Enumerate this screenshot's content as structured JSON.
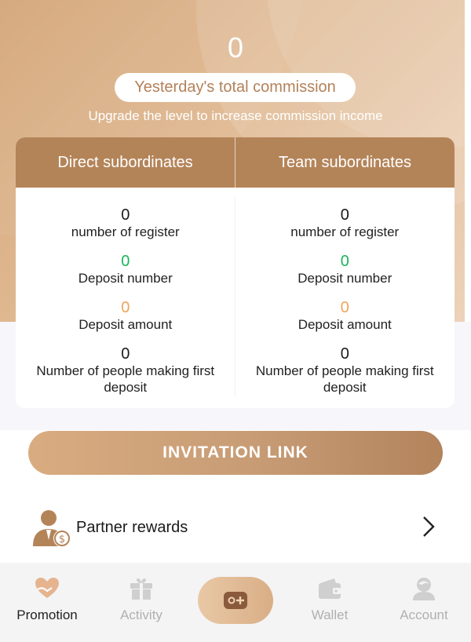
{
  "header": {
    "commission_value": "0",
    "commission_label": "Yesterday's total commission",
    "upgrade_text": "Upgrade the level to increase commission income"
  },
  "subordinates": {
    "direct": {
      "title": "Direct subordinates",
      "register_value": "0",
      "register_label": "number of register",
      "deposit_number_value": "0",
      "deposit_number_label": "Deposit number",
      "deposit_amount_value": "0",
      "deposit_amount_label": "Deposit amount",
      "first_deposit_value": "0",
      "first_deposit_label": "Number of people making first deposit"
    },
    "team": {
      "title": "Team subordinates",
      "register_value": "0",
      "register_label": "number of register",
      "deposit_number_value": "0",
      "deposit_number_label": "Deposit number",
      "deposit_amount_value": "0",
      "deposit_amount_label": "Deposit amount",
      "first_deposit_value": "0",
      "first_deposit_label": "Number of people making first deposit"
    }
  },
  "invitation_link_label": "INVITATION LINK",
  "partner_rewards": {
    "label": "Partner rewards",
    "icon": "partner-money-icon"
  },
  "tabbar": {
    "items": [
      {
        "label": "Promotion",
        "icon": "heart-hand-icon",
        "active": true
      },
      {
        "label": "Activity",
        "icon": "gift-icon",
        "active": false
      },
      {
        "label": "",
        "icon": "game-controller-icon",
        "active": false
      },
      {
        "label": "Wallet",
        "icon": "wallet-icon",
        "active": false
      },
      {
        "label": "Account",
        "icon": "user-icon",
        "active": false
      }
    ]
  },
  "colors": {
    "accent": "#b48459",
    "green": "#19b55a",
    "orange": "#f0a45c",
    "inactive_tab": "#b0b0b0"
  }
}
